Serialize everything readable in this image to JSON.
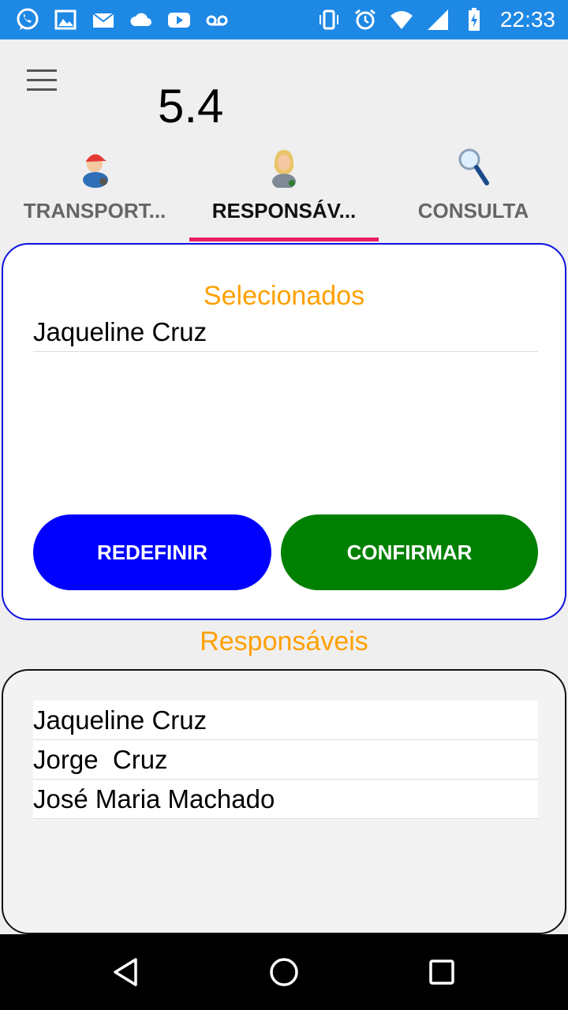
{
  "status_bar": {
    "time": "22:33",
    "left_icons": [
      "whatsapp-icon",
      "gallery-icon",
      "email-icon",
      "cloud-icon",
      "youtube-icon",
      "voicemail-icon"
    ],
    "right_icons": [
      "vibrate-icon",
      "alarm-icon",
      "wifi-icon",
      "signal-icon",
      "battery-charging-icon"
    ]
  },
  "header": {
    "version": "5.4"
  },
  "tabs": [
    {
      "label": "TRANSPORT...",
      "icon": "driver-icon",
      "active": false
    },
    {
      "label": "RESPONSÁV...",
      "icon": "person-icon",
      "active": true
    },
    {
      "label": "CONSULTA",
      "icon": "magnifier-icon",
      "active": false
    }
  ],
  "selected_panel": {
    "title": "Selecionados",
    "items": [
      "Jaqueline Cruz"
    ],
    "reset_label": "REDEFINIR",
    "confirm_label": "CONFIRMAR"
  },
  "responsaveis": {
    "title": "Responsáveis",
    "items": [
      "Jaqueline Cruz",
      "Jorge  Cruz",
      "José Maria Machado"
    ]
  },
  "colors": {
    "status_bar": "#1e88e5",
    "accent_underline": "#e91e63",
    "title_orange": "#ffa000",
    "reset_button": "#0000ff",
    "confirm_button": "#008000"
  }
}
